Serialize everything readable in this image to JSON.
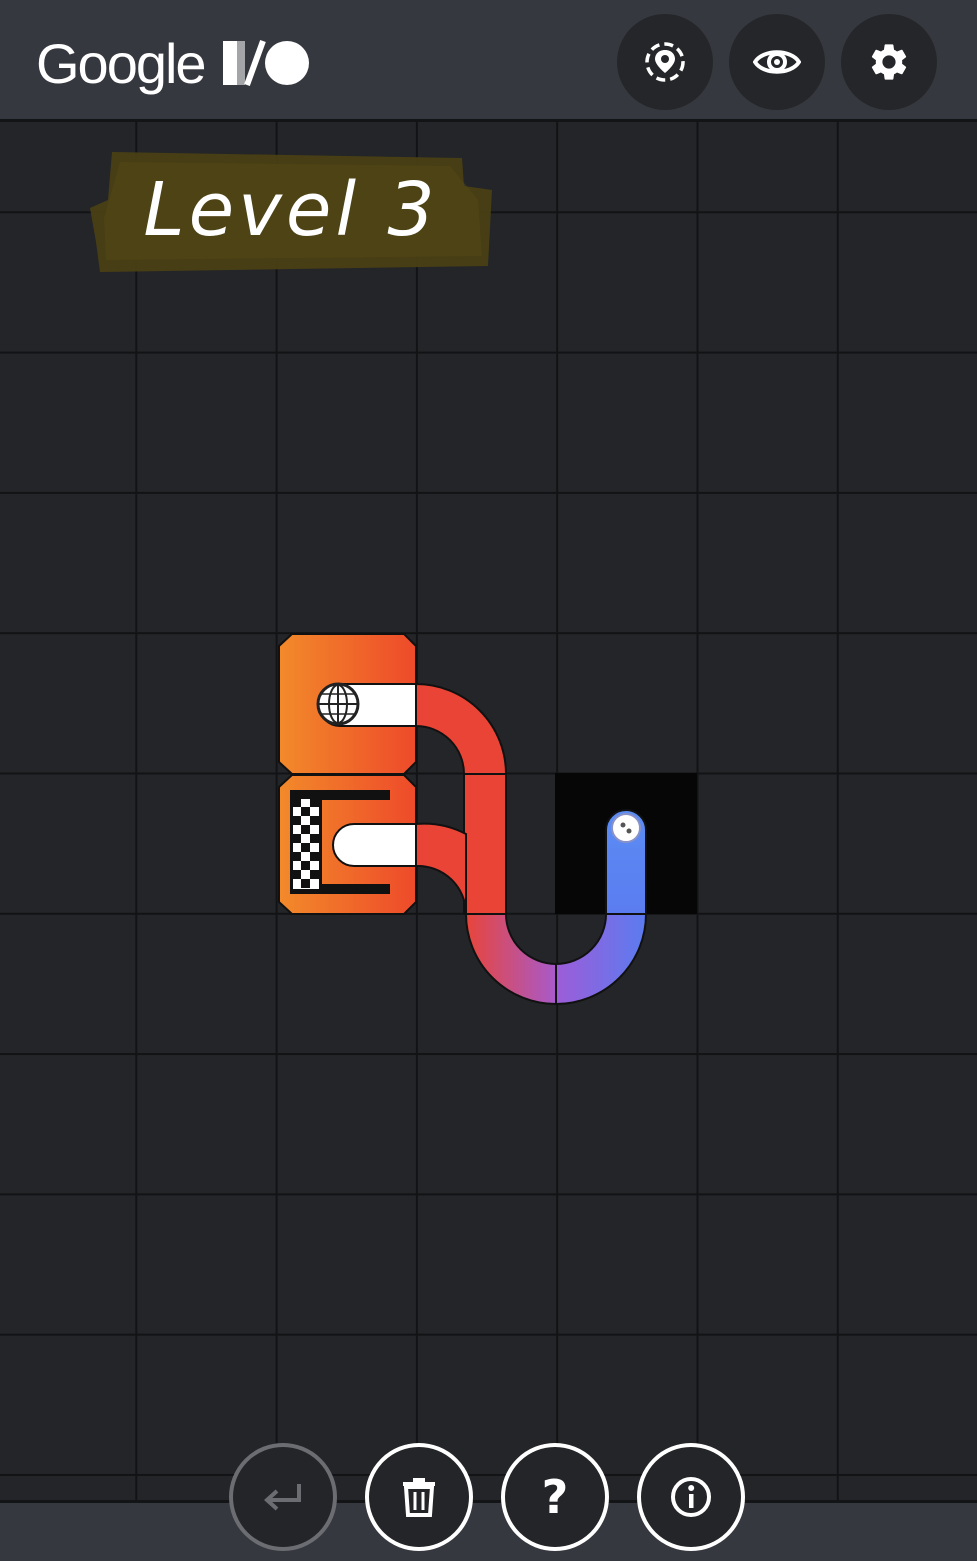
{
  "header": {
    "brand_word": "Google",
    "buttons": [
      {
        "name": "location-button",
        "icon": "location-dashed-icon"
      },
      {
        "name": "visibility-button",
        "icon": "eye-icon"
      },
      {
        "name": "settings-button",
        "icon": "gear-icon"
      }
    ]
  },
  "board": {
    "level_label": "Level 3",
    "colors": {
      "track_start": "#f0552d",
      "track_mid": "#9d5cd8",
      "track_end": "#5b7cf0",
      "station": "#f15a2a",
      "station_left": "#f28a2a",
      "background": "#232528",
      "grid_line": "#121315",
      "label_highlight": "#4a3f14"
    }
  },
  "footer": {
    "buttons": [
      {
        "name": "undo-button",
        "icon": "undo-arrow-icon",
        "enabled": false
      },
      {
        "name": "delete-button",
        "icon": "trash-icon",
        "enabled": true
      },
      {
        "name": "help-button",
        "icon": "question-mark-icon",
        "label": "?",
        "enabled": true
      },
      {
        "name": "info-button",
        "icon": "info-icon",
        "enabled": true
      }
    ]
  }
}
